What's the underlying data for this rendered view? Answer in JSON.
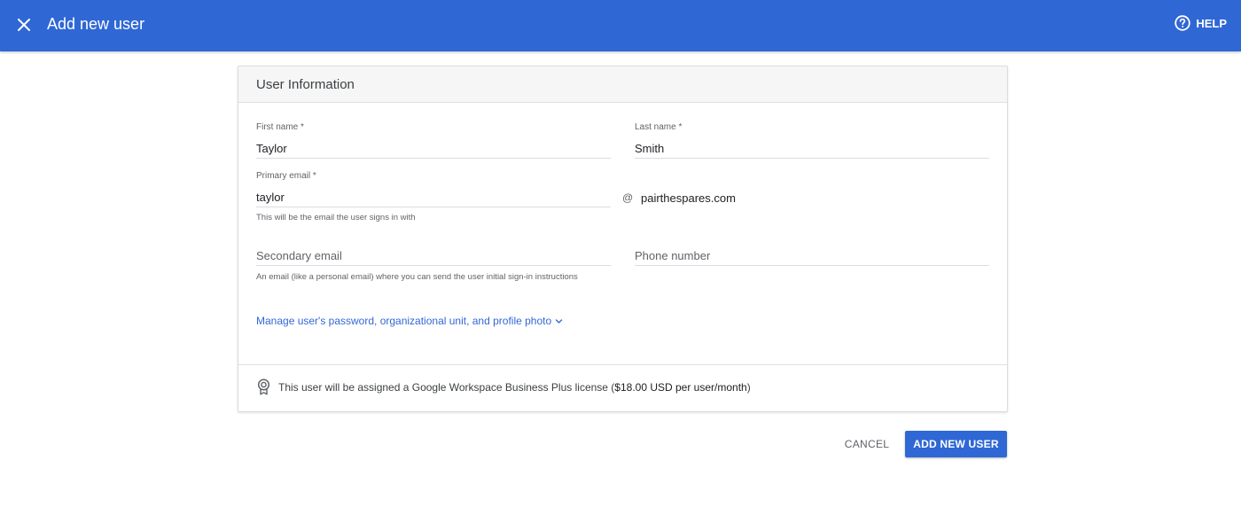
{
  "header": {
    "title": "Add new user",
    "help_label": "HELP",
    "close_icon": "close-icon",
    "help_icon": "help-circle-icon"
  },
  "card": {
    "title": "User Information",
    "first_name": {
      "label": "First name *",
      "value": "Taylor"
    },
    "last_name": {
      "label": "Last name *",
      "value": "Smith"
    },
    "primary_email": {
      "label": "Primary email *",
      "value": "taylor",
      "at": "@",
      "domain": "pairthespares.com",
      "hint": "This will be the email the user signs in with"
    },
    "secondary_email": {
      "placeholder": "Secondary email",
      "hint": "An email (like a personal email) where you can send the user initial sign-in instructions"
    },
    "phone_number": {
      "placeholder": "Phone number"
    },
    "manage_link": "Manage user's password, organizational unit, and profile photo",
    "license": {
      "text": "This user will be assigned a Google Workspace Business Plus license (",
      "price": "$18.00 USD per user/month",
      "close": ")",
      "icon": "license-badge-icon"
    }
  },
  "footer": {
    "cancel_label": "CANCEL",
    "add_label": "ADD NEW USER"
  },
  "colors": {
    "primary": "#2f67d5",
    "link": "#3367d6"
  }
}
